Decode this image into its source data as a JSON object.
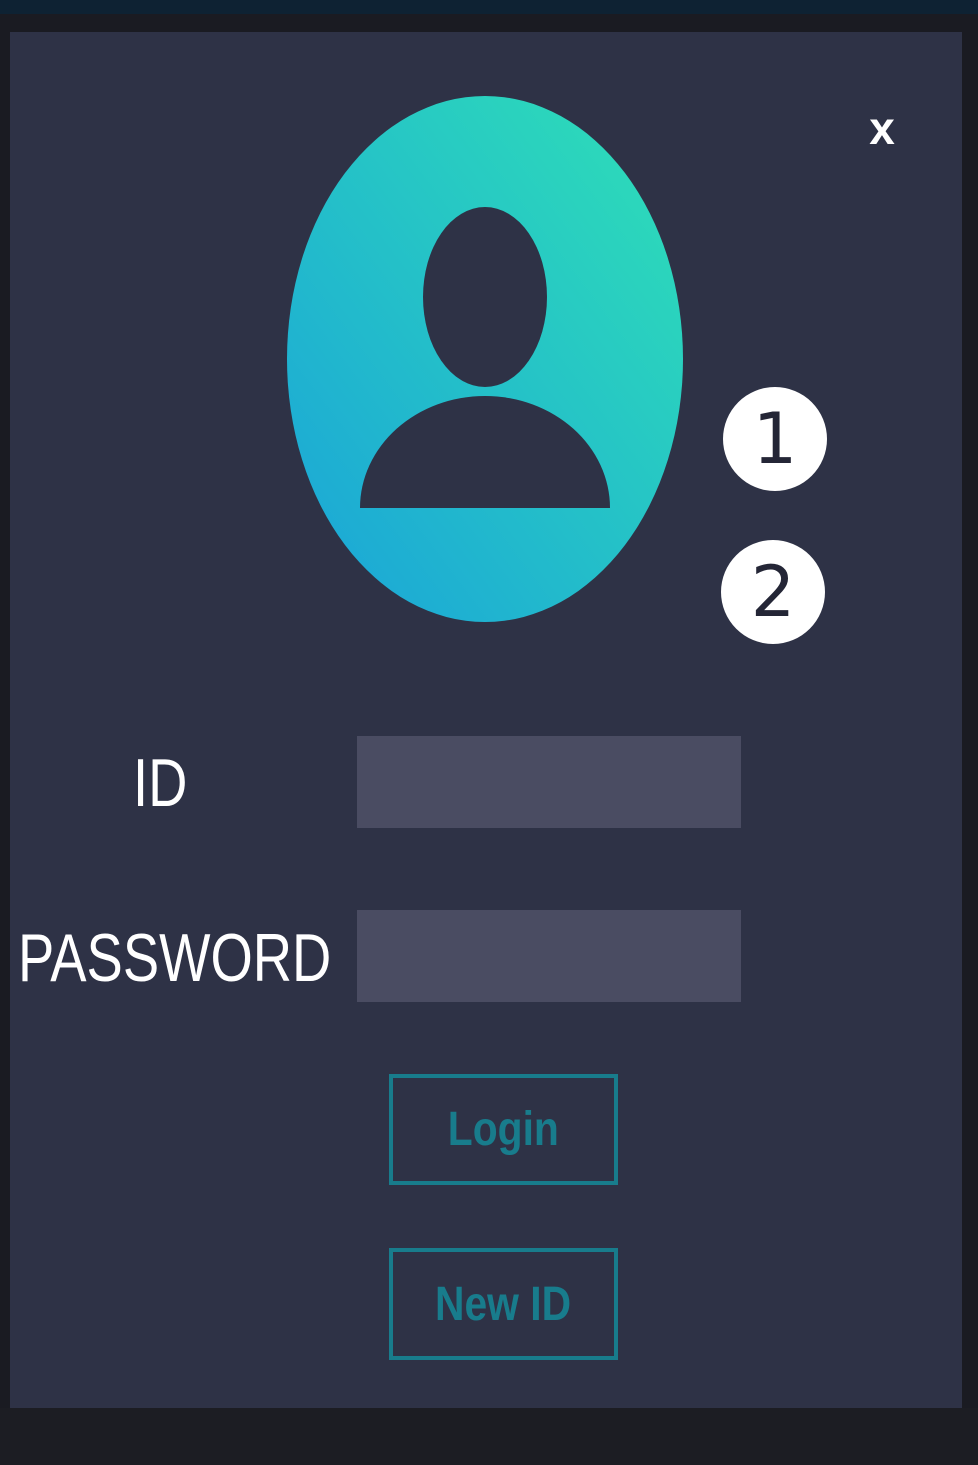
{
  "window": {
    "close_label": "x"
  },
  "avatar": {
    "icon": "user-avatar-icon",
    "gradient_start": "#1aa3d9",
    "gradient_end": "#2fe0b6"
  },
  "annotations": [
    {
      "label": "1"
    },
    {
      "label": "2"
    }
  ],
  "form": {
    "id_label": "ID",
    "id_value": "",
    "password_label": "PASSWORD",
    "password_value": "",
    "field_bg": "#4a4c62"
  },
  "buttons": {
    "login_label": "Login",
    "new_id_label": "New ID",
    "accent": "#187c8c"
  },
  "colors": {
    "panel_bg": "#2e3246",
    "text": "#ffffff"
  }
}
